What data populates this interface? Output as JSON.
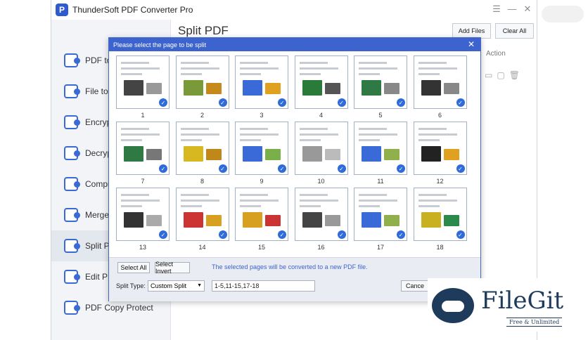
{
  "app": {
    "title": "ThunderSoft PDF Converter Pro"
  },
  "window_controls": {
    "menu": "☰",
    "minimize": "—",
    "close": "✕"
  },
  "sidebar": {
    "items": [
      {
        "label": "PDF to P",
        "icon": "pdf-to-icon"
      },
      {
        "label": "File to P",
        "icon": "file-to-pdf-icon"
      },
      {
        "label": "Encrypt",
        "icon": "lock-icon"
      },
      {
        "label": "Decrypt",
        "icon": "unlock-icon"
      },
      {
        "label": "Compre",
        "icon": "compress-icon"
      },
      {
        "label": "Merge P",
        "icon": "merge-icon"
      },
      {
        "label": "Split PDF",
        "icon": "split-icon"
      },
      {
        "label": "Edit PDF",
        "icon": "edit-icon"
      },
      {
        "label": "PDF Copy Protect",
        "icon": "copy-protect-icon"
      }
    ],
    "active_index": 6
  },
  "main": {
    "title": "Split PDF",
    "add_files_label": "Add Files",
    "clear_all_label": "Clear All",
    "action_header": "Action"
  },
  "dialog": {
    "title": "Please select the page to be split",
    "close": "✕",
    "pages": [
      "1",
      "2",
      "3",
      "4",
      "5",
      "6",
      "7",
      "8",
      "9",
      "10",
      "11",
      "12",
      "13",
      "14",
      "15",
      "16",
      "17",
      "18"
    ],
    "select_all_label": "Select All",
    "select_invert_label": "Select Invert",
    "info_text": "The selected pages will be converted to a new PDF file.",
    "split_type_label": "Split Type:",
    "split_type_value": "Custom Split",
    "range_value": "1-5,11-15,17-18",
    "cancel_label": "Cance"
  },
  "watermark": {
    "name": "FileGit",
    "tagline": "Free & Unlimited"
  },
  "colors": {
    "accent": "#3d63cf",
    "check": "#2f6bd9",
    "brand_dark": "#1f3b5c"
  }
}
